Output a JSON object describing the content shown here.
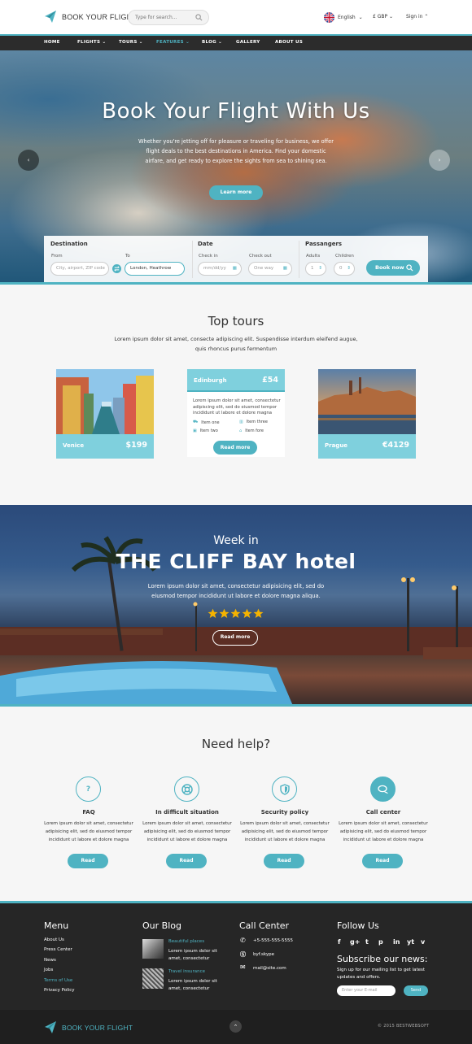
{
  "header": {
    "brand": "BOOK YOUR FLIGHT",
    "search_placeholder": "Type for search...",
    "language": "English",
    "currency": "£ GBP",
    "signin": "Sign in"
  },
  "nav": [
    "HOME",
    "FLIGHTS",
    "TOURS",
    "FEATURES",
    "BLOG",
    "GALLERY",
    "ABOUT US"
  ],
  "hero": {
    "title": "Book Your Flight With Us",
    "text": "Whether you're jetting off for pleasure or traveling for business, we offer flight deals to the best destinations in America. Find your domestic airfare, and get ready to explore the sights from sea to shining sea.",
    "button": "Learn more"
  },
  "booking": {
    "destination_label": "Destination",
    "from_label": "From",
    "from_placeholder": "City, airport, ZIP code",
    "to_label": "To",
    "to_value": "London, Heathrow",
    "date_label": "Date",
    "checkin_label": "Check in",
    "checkin_placeholder": "mm/dd/yy",
    "checkout_label": "Check out",
    "checkout_placeholder": "One way",
    "passengers_label": "Passangers",
    "adults_label": "Adults",
    "adults_value": "1",
    "children_label": "Children",
    "children_value": "0",
    "button": "Book now"
  },
  "tours": {
    "title": "Top tours",
    "subtitle": "Lorem ipsum dolor sit amet, consecte adipiscing elit. Suspendisse interdum eleifend augue, quis rhoncus purus fermentum",
    "cards": [
      {
        "name": "Venice",
        "price": "$199"
      },
      {
        "name": "Edinburgh",
        "price": "£54"
      },
      {
        "name": "Prague",
        "price": "€4129"
      }
    ],
    "featured_desc": "Lorem ipsum dolor sit amet, consectetur adipiscing elit, sed do eiusmod tempor incididunt ut labore et dolore magna",
    "featured_items": [
      "Item one",
      "Item three",
      "Item two",
      "Item fore"
    ],
    "featured_button": "Read more"
  },
  "hotel": {
    "line1": "Week in",
    "line2": "THE CLIFF BAY hotel",
    "text": "Lorem ipsum dolor sit amet, consectetur adipisicing elit, sed do eiusmod tempor incididunt ut labore et dolore magna aliqua.",
    "rating": 5,
    "button": "Read more"
  },
  "help": {
    "title": "Need help?",
    "items": [
      {
        "title": "FAQ",
        "icon": "question-icon",
        "desc": "Lorem ipsum dolor sit amet, consectetur adipisicing elit, sed do eiusmod tempor incididunt ut labore et dolore magna",
        "button": "Read"
      },
      {
        "title": "In difficult situation",
        "icon": "lifebuoy-icon",
        "desc": "Lorem ipsum dolor sit amet, consectetur adipisicing elit, sed do eiusmod tempor incididunt ut labore et dolore magna",
        "button": "Read"
      },
      {
        "title": "Security policy",
        "icon": "shield-icon",
        "desc": "Lorem ipsum dolor sit amet, consectetur adipisicing elit, sed do eiusmod tempor incididunt ut labore et dolore magna",
        "button": "Read"
      },
      {
        "title": "Call center",
        "icon": "chat-icon",
        "desc": "Lorem ipsum dolor sit amet, consectetur adipisicing elit, sed do eiusmod tempor incididunt ut labore et dolore magna",
        "button": "Read"
      }
    ]
  },
  "footer": {
    "menu_title": "Menu",
    "menu": [
      "About Us",
      "Press Center",
      "News",
      "Jobs",
      "Terms of Use",
      "Privacy Policy"
    ],
    "blog_title": "Our Blog",
    "posts": [
      {
        "title": "Beautiful places",
        "text": "Lorem ipsum dolor sit amet, consectetur"
      },
      {
        "title": "Travel insurance",
        "text": "Lorem ipsum dolor sit amet, consectetur"
      }
    ],
    "call_title": "Call Center",
    "phone": "+5-555-555-5555",
    "skype": "byf.skype",
    "email": "mail@site.com",
    "follow_title": "Follow Us",
    "social": [
      "f",
      "g+",
      "t",
      "p",
      "in",
      "yt",
      "v"
    ],
    "subscribe_title": "Subscribe our news:",
    "subscribe_text": "Sign up for our mailing list to get latest updates and offers.",
    "email_placeholder": "Enter your E-mail",
    "send": "Send"
  },
  "bottom": {
    "brand": "BOOK YOUR FLIGHT",
    "copyright": "© 2015 BESTWEBSOFT"
  },
  "colors": {
    "accent": "#4fb3c2",
    "dark": "#262626",
    "card": "#7fd0dd"
  }
}
